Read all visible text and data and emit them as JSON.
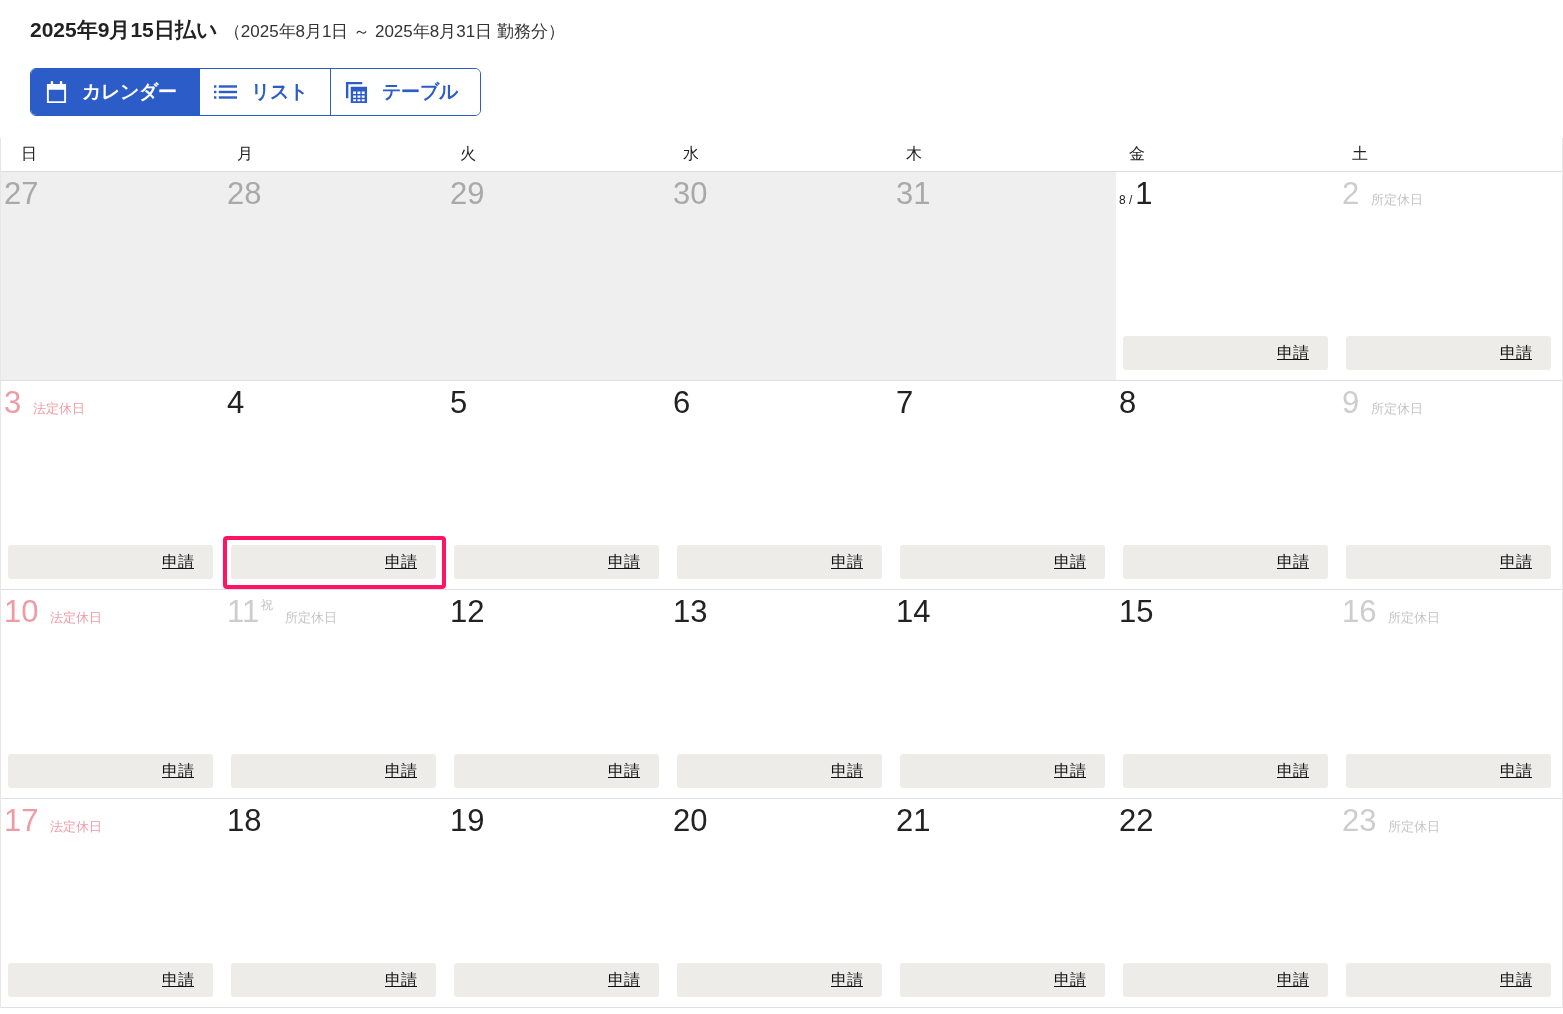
{
  "header": {
    "title": "2025年9月15日払い",
    "period": "（2025年8月1日 ～ 2025年8月31日 勤務分）"
  },
  "view_tabs": [
    {
      "label": "カレンダー",
      "selected": true
    },
    {
      "label": "リスト",
      "selected": false
    },
    {
      "label": "テーブル",
      "selected": false
    }
  ],
  "weekdays": [
    "日",
    "月",
    "火",
    "水",
    "木",
    "金",
    "土"
  ],
  "weeks": [
    {
      "days": [
        {
          "kind": "outside",
          "number": "27"
        },
        {
          "kind": "outside",
          "number": "28"
        },
        {
          "kind": "outside",
          "number": "29"
        },
        {
          "kind": "outside",
          "number": "30"
        },
        {
          "kind": "outside",
          "number": "31"
        },
        {
          "kind": "workday",
          "month_prefix": "8 /",
          "number": "1",
          "apply": {
            "label": "申請",
            "highlighted": false
          }
        },
        {
          "kind": "scheduled_holiday",
          "number": "2",
          "note": "所定休日",
          "apply": {
            "label": "申請",
            "highlighted": false
          }
        }
      ]
    },
    {
      "days": [
        {
          "kind": "legal_holiday",
          "number": "3",
          "note": "法定休日",
          "apply": {
            "label": "申請",
            "highlighted": false
          }
        },
        {
          "kind": "workday",
          "number": "4",
          "apply": {
            "label": "申請",
            "highlighted": true
          }
        },
        {
          "kind": "workday",
          "number": "5",
          "apply": {
            "label": "申請",
            "highlighted": false
          }
        },
        {
          "kind": "workday",
          "number": "6",
          "apply": {
            "label": "申請",
            "highlighted": false
          }
        },
        {
          "kind": "workday",
          "number": "7",
          "apply": {
            "label": "申請",
            "highlighted": false
          }
        },
        {
          "kind": "workday",
          "number": "8",
          "apply": {
            "label": "申請",
            "highlighted": false
          }
        },
        {
          "kind": "scheduled_holiday",
          "number": "9",
          "note": "所定休日",
          "apply": {
            "label": "申請",
            "highlighted": false
          }
        }
      ]
    },
    {
      "days": [
        {
          "kind": "legal_holiday",
          "number": "10",
          "note": "法定休日",
          "apply": {
            "label": "申請",
            "highlighted": false
          }
        },
        {
          "kind": "scheduled_holiday",
          "number": "11",
          "holiday_mark": "祝",
          "note": "所定休日",
          "apply": {
            "label": "申請",
            "highlighted": false
          }
        },
        {
          "kind": "workday",
          "number": "12",
          "apply": {
            "label": "申請",
            "highlighted": false
          }
        },
        {
          "kind": "workday",
          "number": "13",
          "apply": {
            "label": "申請",
            "highlighted": false
          }
        },
        {
          "kind": "workday",
          "number": "14",
          "apply": {
            "label": "申請",
            "highlighted": false
          }
        },
        {
          "kind": "workday",
          "number": "15",
          "apply": {
            "label": "申請",
            "highlighted": false
          }
        },
        {
          "kind": "scheduled_holiday",
          "number": "16",
          "note": "所定休日",
          "apply": {
            "label": "申請",
            "highlighted": false
          }
        }
      ]
    },
    {
      "days": [
        {
          "kind": "legal_holiday",
          "number": "17",
          "note": "法定休日",
          "apply": {
            "label": "申請",
            "highlighted": false
          }
        },
        {
          "kind": "workday",
          "number": "18",
          "apply": {
            "label": "申請",
            "highlighted": false
          }
        },
        {
          "kind": "workday",
          "number": "19",
          "apply": {
            "label": "申請",
            "highlighted": false
          }
        },
        {
          "kind": "workday",
          "number": "20",
          "apply": {
            "label": "申請",
            "highlighted": false
          }
        },
        {
          "kind": "workday",
          "number": "21",
          "apply": {
            "label": "申請",
            "highlighted": false
          }
        },
        {
          "kind": "workday",
          "number": "22",
          "apply": {
            "label": "申請",
            "highlighted": false
          }
        },
        {
          "kind": "scheduled_holiday",
          "number": "23",
          "note": "所定休日",
          "apply": {
            "label": "申請",
            "highlighted": false
          }
        }
      ]
    }
  ]
}
